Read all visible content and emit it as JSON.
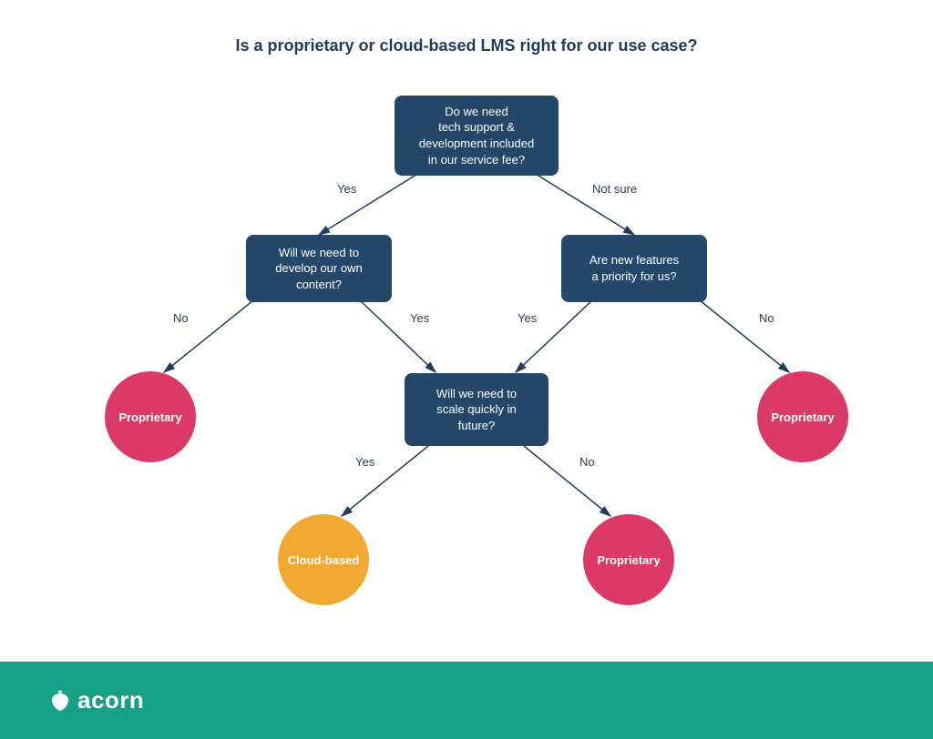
{
  "title": "Is a proprietary or cloud-based LMS right for our use case?",
  "nodes": {
    "q1": "Do we need\ntech support &\ndevelopment included\nin our service fee?",
    "q2": "Will we need to\ndevelop our own\ncontent?",
    "q3": "Are new features\na priority for us?",
    "q4": "Will we need to\nscale quickly in\nfuture?",
    "r_prop_left": "Proprietary",
    "r_prop_right": "Proprietary",
    "r_prop_bottom": "Proprietary",
    "r_cloud": "Cloud-based"
  },
  "labels": {
    "q1_yes": "Yes",
    "q1_notsure": "Not sure",
    "q2_no": "No",
    "q2_yes": "Yes",
    "q3_yes": "Yes",
    "q3_no": "No",
    "q4_yes": "Yes",
    "q4_no": "No"
  },
  "brand": "acorn",
  "colors": {
    "box": "#24476a",
    "pink": "#db3a66",
    "orange": "#f2a932",
    "footer": "#16a085"
  }
}
